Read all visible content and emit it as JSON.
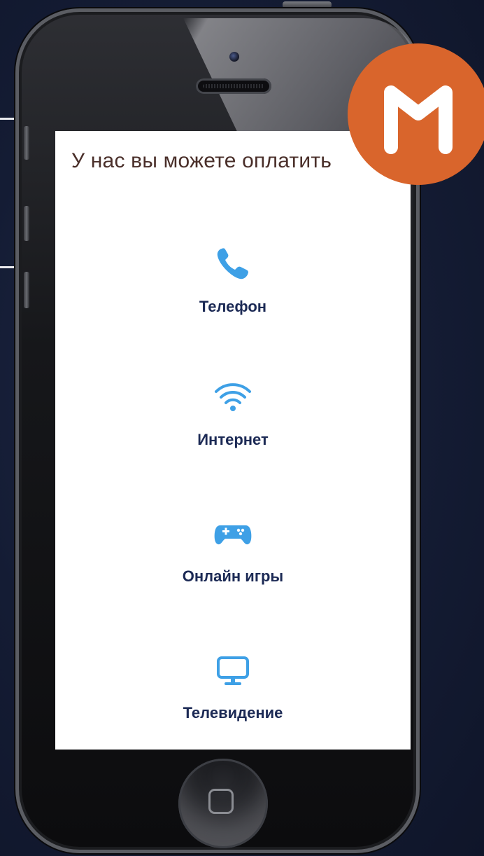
{
  "screen": {
    "title": "У нас вы можете оплатить"
  },
  "services": [
    {
      "label": "Телефон",
      "icon": "phone-icon"
    },
    {
      "label": "Интернет",
      "icon": "wifi-icon"
    },
    {
      "label": "Онлайн игры",
      "icon": "gamepad-icon"
    },
    {
      "label": "Телевидение",
      "icon": "tv-monitor-icon"
    }
  ],
  "logo": {
    "letter": "M",
    "color": "#d9652c"
  },
  "colors": {
    "background": "#141c34",
    "icon_blue": "#3ea0e6",
    "label_navy": "#1c2a55",
    "title_brown": "#4a2f2a"
  }
}
